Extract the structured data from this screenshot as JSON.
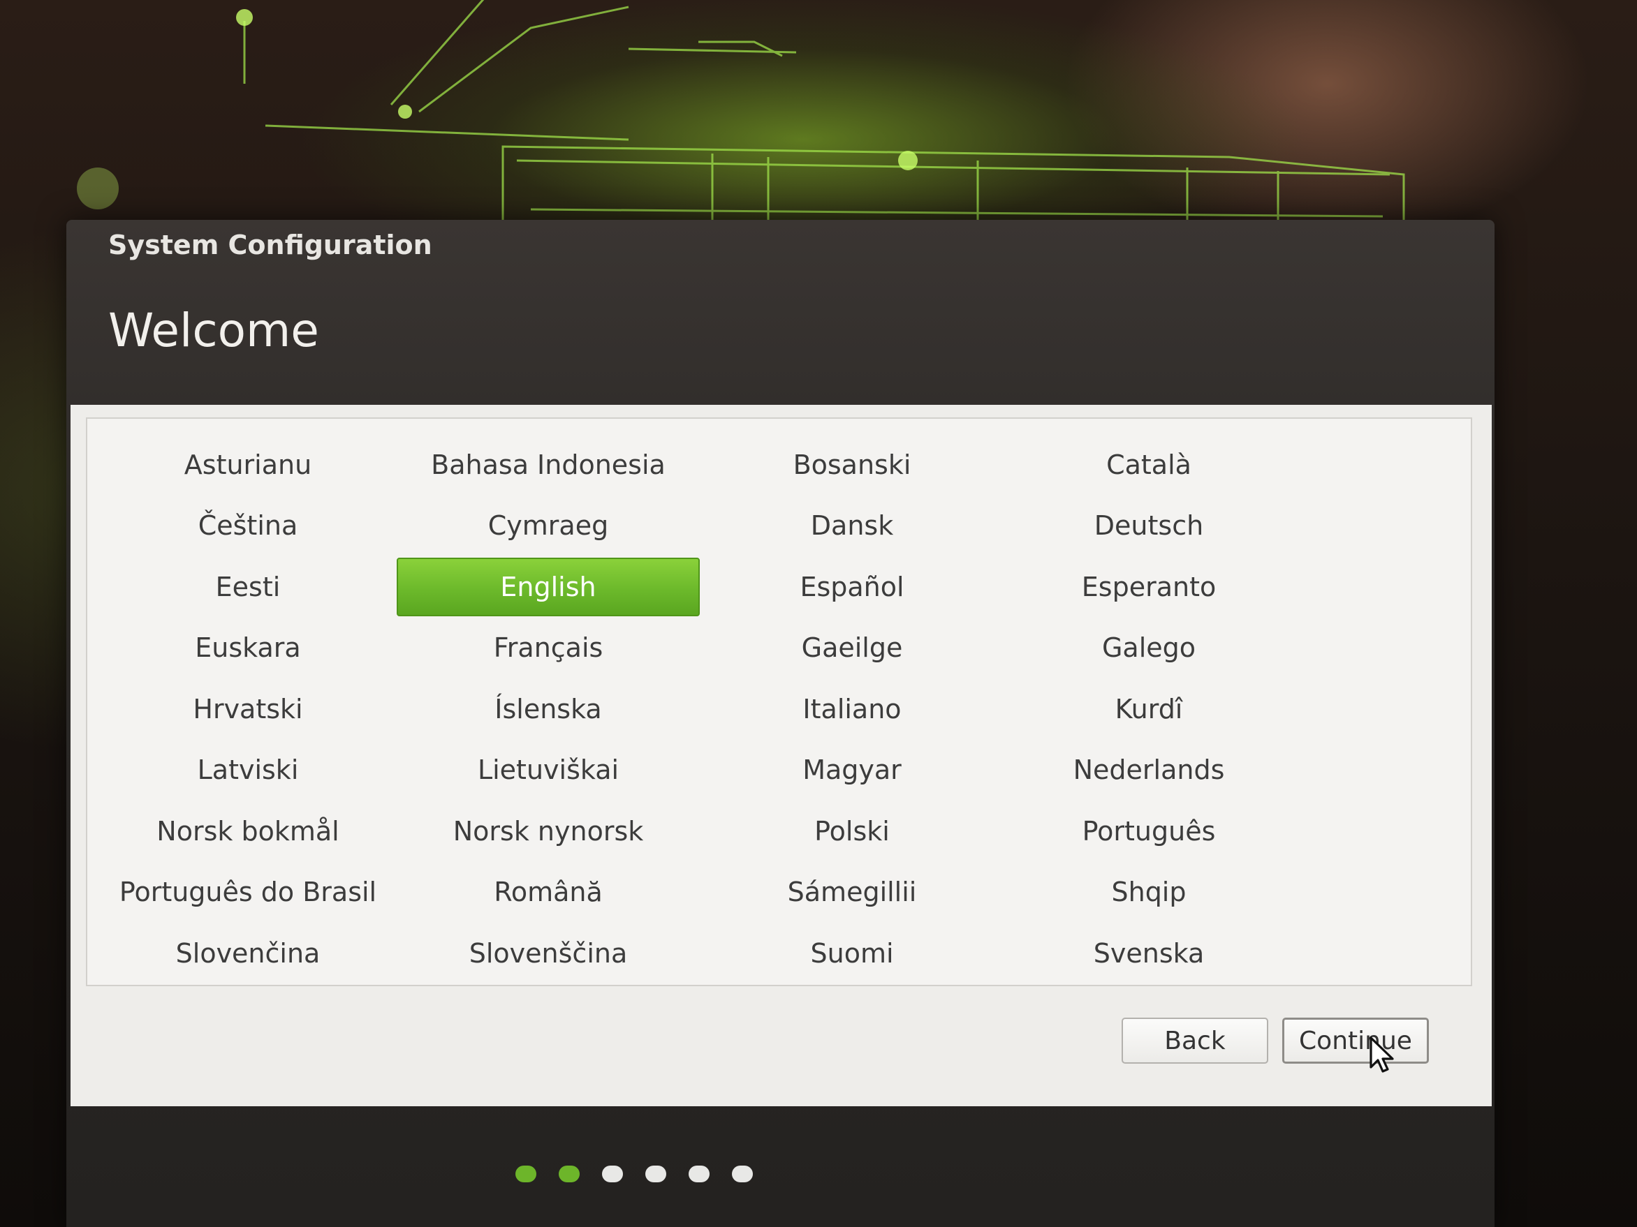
{
  "window": {
    "title": "System Configuration",
    "heading": "Welcome"
  },
  "languages": [
    "Asturianu",
    "Bahasa Indonesia",
    "Bosanski",
    "Català",
    "Čeština",
    "Cymraeg",
    "Dansk",
    "Deutsch",
    "Eesti",
    "English",
    "Español",
    "Esperanto",
    "Euskara",
    "Français",
    "Gaeilge",
    "Galego",
    "Hrvatski",
    "Íslenska",
    "Italiano",
    "Kurdî",
    "Latviski",
    "Lietuviškai",
    "Magyar",
    "Nederlands",
    "Norsk bokmål",
    "Norsk nynorsk",
    "Polski",
    "Português",
    "Português do Brasil",
    "Română",
    "Sámegillii",
    "Shqip",
    "Slovenčina",
    "Slovenščina",
    "Suomi",
    "Svenska"
  ],
  "selected_language": "English",
  "buttons": {
    "back": "Back",
    "continue": "Continue"
  },
  "progress": {
    "total_steps": 6,
    "completed_steps": 2
  },
  "colors": {
    "accent": "#6cb92b",
    "selected_text": "#ffffff"
  }
}
